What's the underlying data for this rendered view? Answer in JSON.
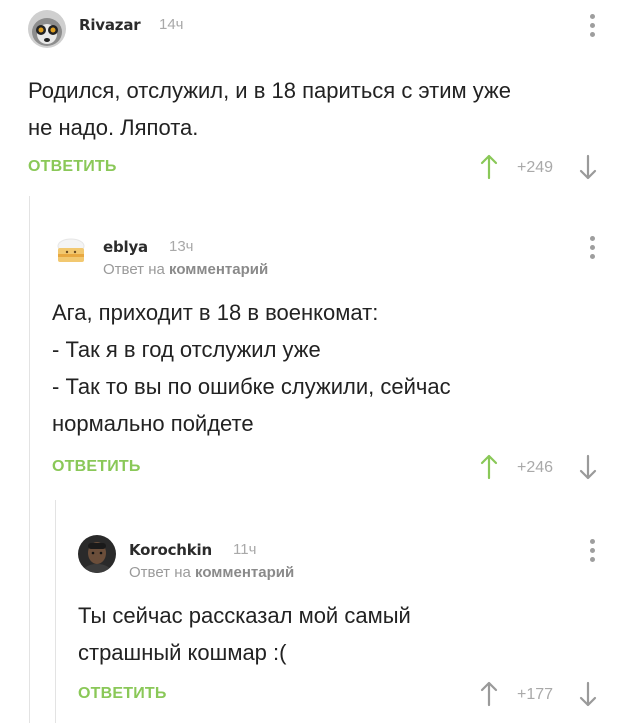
{
  "colors": {
    "accent_green": "#8ac858",
    "muted_gray": "#a9a9a9",
    "text": "#222222"
  },
  "comments": [
    {
      "author": "Rivazar",
      "time": "14ч",
      "avatar_icon": "lemur-avatar",
      "lines": [
        "Родился, отслужил, и в 18 париться с этим уже",
        "не надо. Ляпота."
      ],
      "reply_label": "ОТВЕТИТЬ",
      "score": "+249"
    },
    {
      "author": "eblya",
      "time": "13ч",
      "avatar_icon": "cake-avatar",
      "reply_to_prefix": "Ответ на",
      "reply_to_link": "комментарий",
      "lines": [
        "Ага, приходит в 18 в военкомат:",
        "- Так я в год отслужил уже",
        "- Так то вы по ошибке служили, сейчас",
        "нормально пойдете"
      ],
      "reply_label": "ОТВЕТИТЬ",
      "score": "+246"
    },
    {
      "author": "Korochkin",
      "time": "11ч",
      "avatar_icon": "man-avatar",
      "reply_to_prefix": "Ответ на",
      "reply_to_link": "комментарий",
      "lines": [
        "Ты сейчас рассказал мой самый",
        "страшный кошмар :("
      ],
      "reply_label": "ОТВЕТИТЬ",
      "score": "+177"
    }
  ]
}
